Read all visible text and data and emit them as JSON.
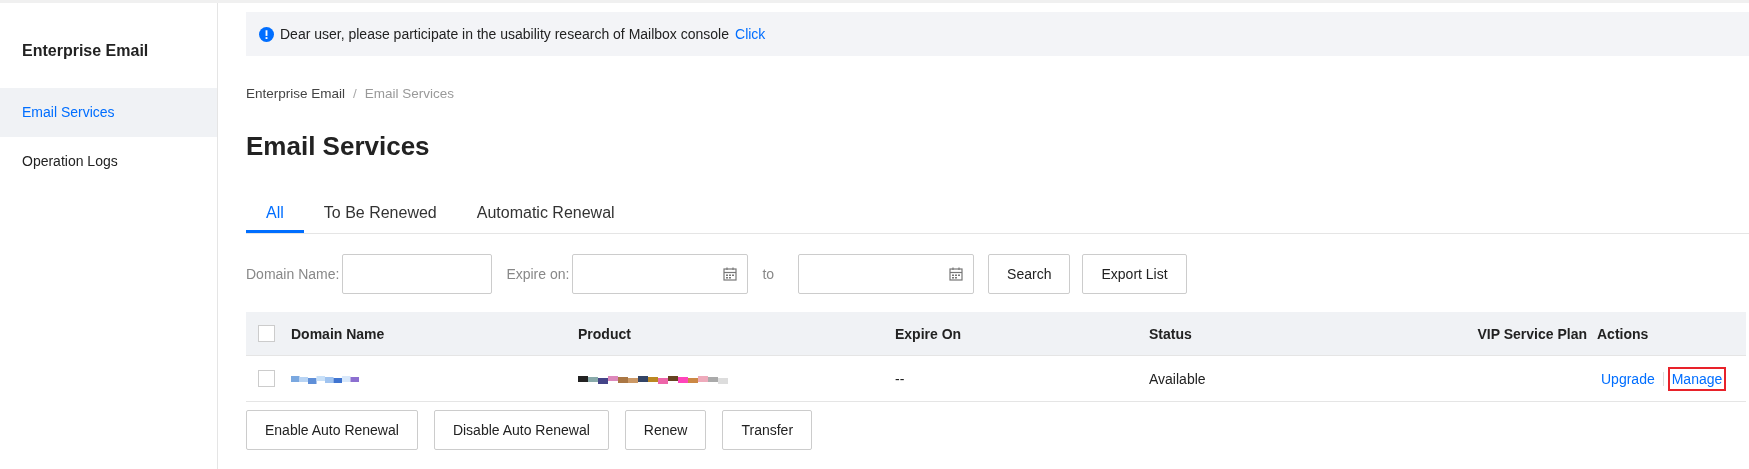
{
  "sidebar": {
    "title": "Enterprise Email",
    "items": [
      {
        "label": "Email Services",
        "selected": true
      },
      {
        "label": "Operation Logs",
        "selected": false
      }
    ]
  },
  "notice": {
    "text": "Dear user, please participate in the usability research of Mailbox console",
    "link": "Click"
  },
  "breadcrumb": [
    {
      "label": "Enterprise Email",
      "current": false
    },
    {
      "label": "Email Services",
      "current": true
    }
  ],
  "breadcrumb_separator": "/",
  "page_title": "Email Services",
  "tabs": [
    {
      "label": "All",
      "selected": true
    },
    {
      "label": "To Be Renewed",
      "selected": false
    },
    {
      "label": "Automatic Renewal",
      "selected": false
    }
  ],
  "filters": {
    "domain_label": "Domain Name:",
    "expire_label": "Expire on:",
    "to_label": "to",
    "buttons": [
      "Search",
      "Export List"
    ]
  },
  "table": {
    "select_all_checked": false,
    "columns": [
      "Domain Name",
      "Product",
      "Expire On",
      "Status",
      "VIP Service Plan",
      "Actions"
    ],
    "rows": [
      {
        "checked": false,
        "domain": {
          "kind": "redacted"
        },
        "product": {
          "kind": "redacted"
        },
        "expire_on": "--",
        "status": "Available",
        "actions": [
          {
            "label": "Upgrade",
            "highlighted": false
          },
          {
            "label": "Manage",
            "highlighted": true
          }
        ]
      }
    ]
  },
  "bulk_buttons": [
    "Enable Auto Renewal",
    "Disable Auto Renewal",
    "Renew",
    "Transfer"
  ]
}
